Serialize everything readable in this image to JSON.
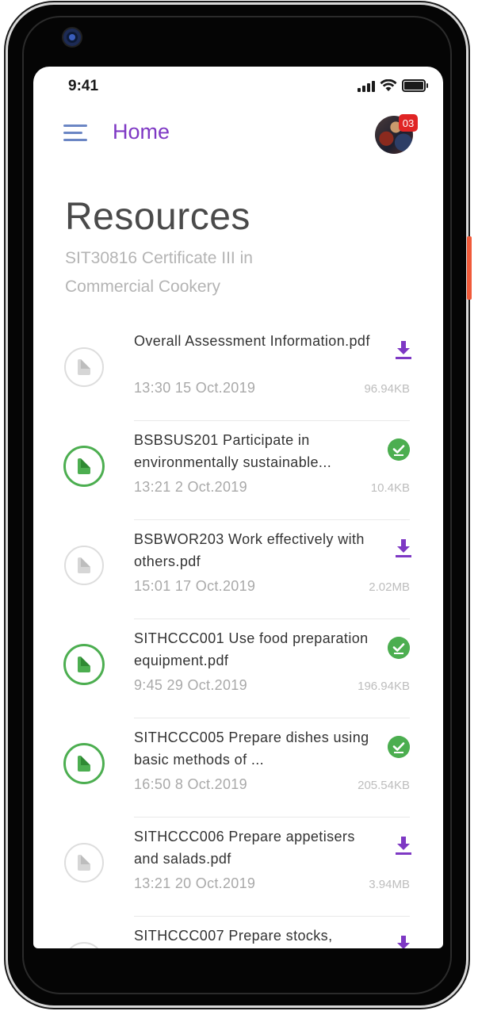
{
  "status_bar": {
    "time": "9:41"
  },
  "header": {
    "title": "Home",
    "notification_count": "03"
  },
  "page": {
    "title": "Resources",
    "subtitle": "SIT30816 Certificate III in Commercial Cookery"
  },
  "resources": [
    {
      "name": "Overall Assessment Information.pdf",
      "time": "13:30 15 Oct.2019",
      "size": "96.94KB",
      "status": "download"
    },
    {
      "name": "BSBSUS201 Participate in environmentally sustainable...",
      "time": "13:21 2 Oct.2019",
      "size": "10.4KB",
      "status": "downloaded"
    },
    {
      "name": "BSBWOR203 Work effectively with others.pdf",
      "time": "15:01 17 Oct.2019",
      "size": "2.02MB",
      "status": "download"
    },
    {
      "name": "SITHCCC001 Use food preparation equipment.pdf",
      "time": "9:45 29 Oct.2019",
      "size": "196.94KB",
      "status": "downloaded"
    },
    {
      "name": "SITHCCC005 Prepare dishes using basic methods of ...",
      "time": "16:50 8 Oct.2019",
      "size": "205.54KB",
      "status": "downloaded"
    },
    {
      "name": "SITHCCC006 Prepare appetisers and salads.pdf",
      "time": "13:21 20 Oct.2019",
      "size": "3.94MB",
      "status": "download"
    },
    {
      "name": "SITHCCC007 Prepare stocks,",
      "time": "",
      "size": "",
      "status": "download"
    }
  ],
  "colors": {
    "accent": "#7e38c4",
    "success": "#4cae50",
    "badge": "#e02424",
    "menu_icon": "#6b86c4"
  },
  "icons": {
    "menu": "hamburger-menu-icon",
    "download": "download-icon",
    "downloaded": "check-circle-icon",
    "file": "document-icon"
  }
}
